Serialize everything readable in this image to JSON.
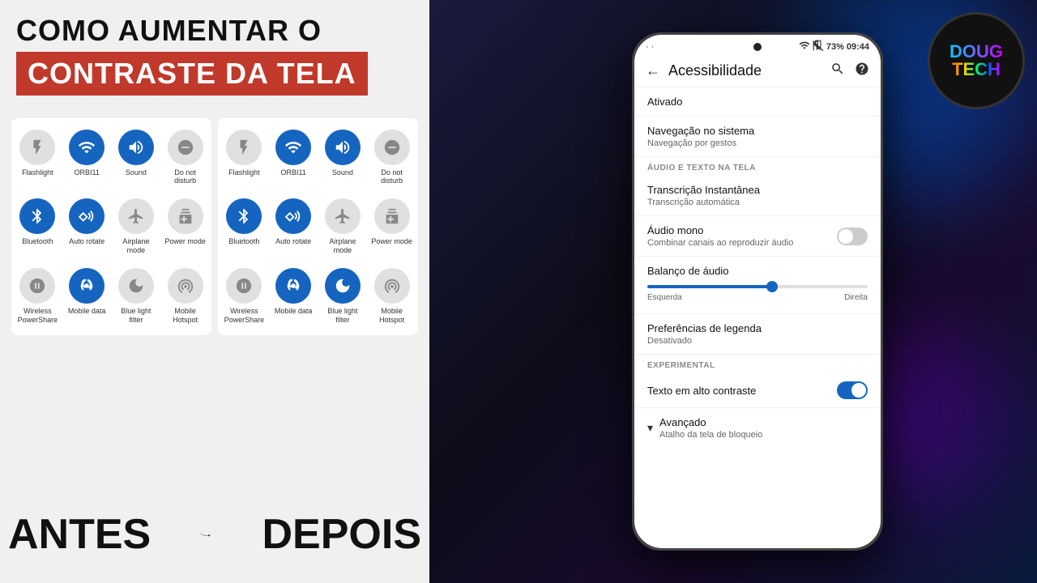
{
  "leftPanel": {
    "titleLine1": "COMO AUMENTAR O",
    "titleLine2": "CONTRASTE DA TELA",
    "beforeLabel": "ANTES",
    "afterLabel": "DEPOIS",
    "beforeTiles": [
      {
        "id": "flashlight-before",
        "label": "Flashlight",
        "active": false,
        "icon": "💡"
      },
      {
        "id": "orbi11-before",
        "label": "ORBI11",
        "active": true,
        "icon": "📶"
      },
      {
        "id": "sound-before",
        "label": "Sound",
        "active": true,
        "icon": "🔊"
      },
      {
        "id": "donotdisturb-before",
        "label": "Do not disturb",
        "active": false,
        "icon": "⊖"
      },
      {
        "id": "bluetooth-before",
        "label": "Bluetooth",
        "active": true,
        "icon": "🔵"
      },
      {
        "id": "autorotate-before",
        "label": "Auto rotate",
        "active": true,
        "icon": "🔄"
      },
      {
        "id": "airplanemode-before",
        "label": "Airplane mode",
        "active": false,
        "icon": "✈"
      },
      {
        "id": "powermode-before",
        "label": "Power mode",
        "active": false,
        "icon": "🔋"
      },
      {
        "id": "wirelesspowershare-before",
        "label": "Wireless PowerShare",
        "active": false,
        "icon": "⚡"
      },
      {
        "id": "mobiledata-before",
        "label": "Mobile data",
        "active": true,
        "icon": "📶"
      },
      {
        "id": "bluelightfilter-before",
        "label": "Blue light filter",
        "active": false,
        "icon": "🌙"
      },
      {
        "id": "mobilehotspot-before",
        "label": "Mobile Hotspot",
        "active": false,
        "icon": "📱"
      }
    ],
    "afterTiles": [
      {
        "id": "flashlight-after",
        "label": "Flashlight",
        "active": false,
        "icon": "💡"
      },
      {
        "id": "orbi11-after",
        "label": "ORBI11",
        "active": true,
        "icon": "📶"
      },
      {
        "id": "sound-after",
        "label": "Sound",
        "active": true,
        "icon": "🔊"
      },
      {
        "id": "donotdisturb-after",
        "label": "Do not disturb",
        "active": false,
        "icon": "⊖"
      },
      {
        "id": "bluetooth-after",
        "label": "Bluetooth",
        "active": true,
        "icon": "🔵"
      },
      {
        "id": "autorotate-after",
        "label": "Auto rotate",
        "active": true,
        "icon": "🔄"
      },
      {
        "id": "airplanemode-after",
        "label": "Airplane mode",
        "active": false,
        "icon": "✈"
      },
      {
        "id": "powermode-after",
        "label": "Power mode",
        "active": false,
        "icon": "🔋"
      },
      {
        "id": "wirelesspowershare-after",
        "label": "Wireless PowerShare",
        "active": false,
        "icon": "⚡"
      },
      {
        "id": "mobiledata-after",
        "label": "Mobile data",
        "active": true,
        "icon": "📶"
      },
      {
        "id": "bluelightfilter-after",
        "label": "Blue light filter",
        "active": true,
        "icon": "🌙"
      },
      {
        "id": "mobilehotspot-after",
        "label": "Mobile Hotspot",
        "active": false,
        "icon": "📱"
      }
    ]
  },
  "phone": {
    "statusBar": {
      "time": "09:44",
      "battery": "73%",
      "signal": "●"
    },
    "header": {
      "title": "Acessibilidade",
      "backIcon": "←",
      "searchIcon": "🔍",
      "helpIcon": "?"
    },
    "settings": [
      {
        "id": "ativado",
        "title": "Ativado",
        "sub": "",
        "type": "simple"
      },
      {
        "id": "navegacao",
        "title": "Navegação no sistema",
        "sub": "Navegação por gestos",
        "type": "simple"
      },
      {
        "id": "audio-section",
        "title": "ÁUDIO E TEXTO NA TELA",
        "type": "section"
      },
      {
        "id": "transcricao",
        "title": "Transcrição Instantânea",
        "sub": "Transcrição automática",
        "type": "simple"
      },
      {
        "id": "audiomono",
        "title": "Áudio mono",
        "sub": "Combinar canais ao reproduzir áudio",
        "type": "toggle",
        "toggleState": "off"
      },
      {
        "id": "balanco",
        "title": "Balanço de áudio",
        "type": "slider",
        "leftLabel": "Esquerda",
        "rightLabel": "Direita"
      },
      {
        "id": "preferencias",
        "title": "Preferências de legenda",
        "sub": "Desativado",
        "type": "simple"
      },
      {
        "id": "experimental-section",
        "title": "EXPERIMENTAL",
        "type": "section"
      },
      {
        "id": "textocontraste",
        "title": "Texto em alto contraste",
        "type": "toggle-blue"
      },
      {
        "id": "avancado",
        "title": "Avançado",
        "sub": "Atalho da tela de bloqueio",
        "type": "expand"
      }
    ]
  },
  "dougtech": {
    "line1": "DOUG",
    "line2": "TECH"
  }
}
